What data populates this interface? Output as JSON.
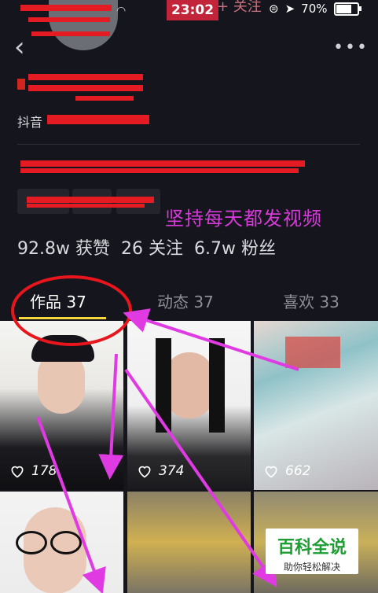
{
  "status_bar": {
    "time": "23:02",
    "ghost_text": "+ 关注",
    "battery": "70%"
  },
  "profile": {
    "douyin_prefix": "抖音",
    "motto_overlay": "坚持每天都发视频",
    "stats": {
      "likes_value": "92.8w",
      "likes_label": "获赞",
      "following_value": "26",
      "following_label": "关注",
      "fans_value": "6.7w",
      "fans_label": "粉丝"
    }
  },
  "tabs": [
    {
      "label": "作品 37"
    },
    {
      "label": "动态 37"
    },
    {
      "label": "喜欢 33"
    }
  ],
  "videos": [
    {
      "likes": "178"
    },
    {
      "likes": "374"
    },
    {
      "likes": "662"
    }
  ],
  "watermark": {
    "title": "百科全说",
    "subtitle": "助你轻松解决"
  },
  "colors": {
    "annotation_red": "#e8151c",
    "arrow_magenta": "#e03ae3",
    "tab_underline": "#f4d83d"
  }
}
